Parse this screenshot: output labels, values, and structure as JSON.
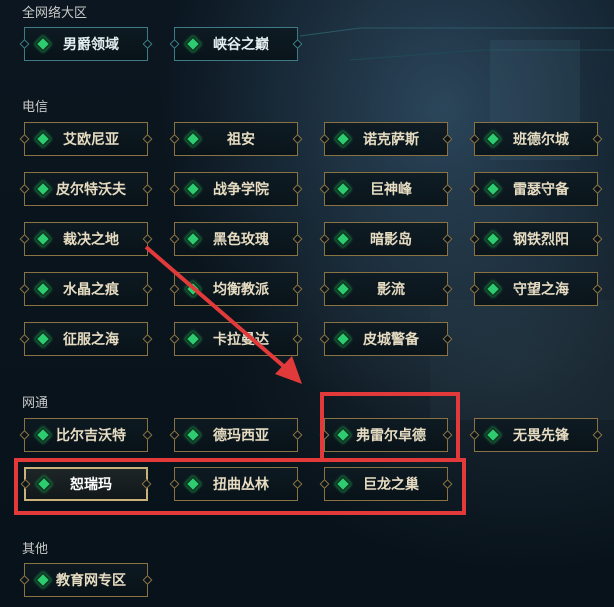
{
  "sections": {
    "all": "全网络大区",
    "telecom": "电信",
    "netcom": "网通",
    "other": "其他"
  },
  "servers": {
    "all": [
      "男爵领域",
      "峡谷之巅"
    ],
    "telecom": [
      [
        "艾欧尼亚",
        "祖安",
        "诺克萨斯",
        "班德尔城"
      ],
      [
        "皮尔特沃夫",
        "战争学院",
        "巨神峰",
        "雷瑟守备"
      ],
      [
        "裁决之地",
        "黑色玫瑰",
        "暗影岛",
        "钢铁烈阳"
      ],
      [
        "水晶之痕",
        "均衡教派",
        "影流",
        "守望之海"
      ],
      [
        "征服之海",
        "卡拉曼达",
        "皮城警备"
      ]
    ],
    "netcom": [
      [
        "比尔吉沃特",
        "德玛西亚",
        "弗雷尔卓德",
        "无畏先锋"
      ],
      [
        "恕瑞玛",
        "扭曲丛林",
        "巨龙之巢"
      ]
    ],
    "other": [
      "教育网专区"
    ]
  },
  "selected": "恕瑞玛",
  "colors": {
    "annotation": "#e23a3a",
    "button_border": "#8a7342",
    "gem": "#2ecc71"
  }
}
